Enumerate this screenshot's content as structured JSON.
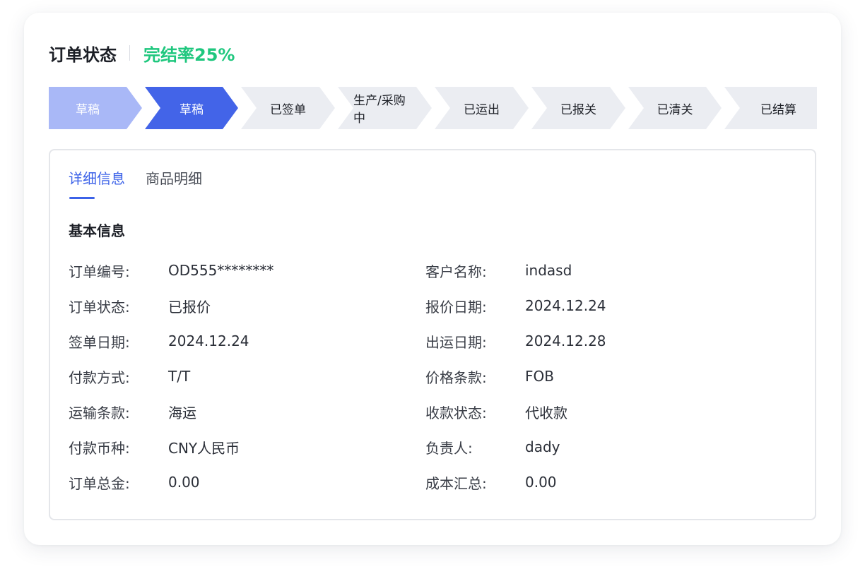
{
  "header": {
    "title": "订单状态",
    "rate": "完结率25%"
  },
  "steps": [
    {
      "label": "草稿",
      "state": "done"
    },
    {
      "label": "草稿",
      "state": "active"
    },
    {
      "label": "已签单",
      "state": "pending"
    },
    {
      "label": "生产/采购中",
      "state": "pending"
    },
    {
      "label": "已运出",
      "state": "pending"
    },
    {
      "label": "已报关",
      "state": "pending"
    },
    {
      "label": "已清关",
      "state": "pending"
    },
    {
      "label": "已结算",
      "state": "pending"
    }
  ],
  "colors": {
    "done": "#a9b8f7",
    "active": "#4364e8",
    "pending": "#ebedf2",
    "accent": "#3c62e8",
    "rate": "#1fc77e"
  },
  "tabs": [
    {
      "label": "详细信息",
      "active": true
    },
    {
      "label": "商品明细",
      "active": false
    }
  ],
  "section_title": "基本信息",
  "fields_left": [
    {
      "label": "订单编号:",
      "value": "OD555********"
    },
    {
      "label": "订单状态:",
      "value": "已报价"
    },
    {
      "label": "签单日期:",
      "value": "2024.12.24"
    },
    {
      "label": "付款方式:",
      "value": "T/T"
    },
    {
      "label": "运输条款:",
      "value": "海运"
    },
    {
      "label": "付款币种:",
      "value": "CNY人民币"
    },
    {
      "label": "订单总金:",
      "value": "0.00"
    }
  ],
  "fields_right": [
    {
      "label": "客户名称:",
      "value": "indasd"
    },
    {
      "label": "报价日期:",
      "value": "2024.12.24"
    },
    {
      "label": "出运日期:",
      "value": "2024.12.28"
    },
    {
      "label": "价格条款:",
      "value": "FOB"
    },
    {
      "label": "收款状态:",
      "value": "代收款"
    },
    {
      "label": "负责人:",
      "value": "dady"
    },
    {
      "label": "成本汇总:",
      "value": "0.00"
    }
  ]
}
